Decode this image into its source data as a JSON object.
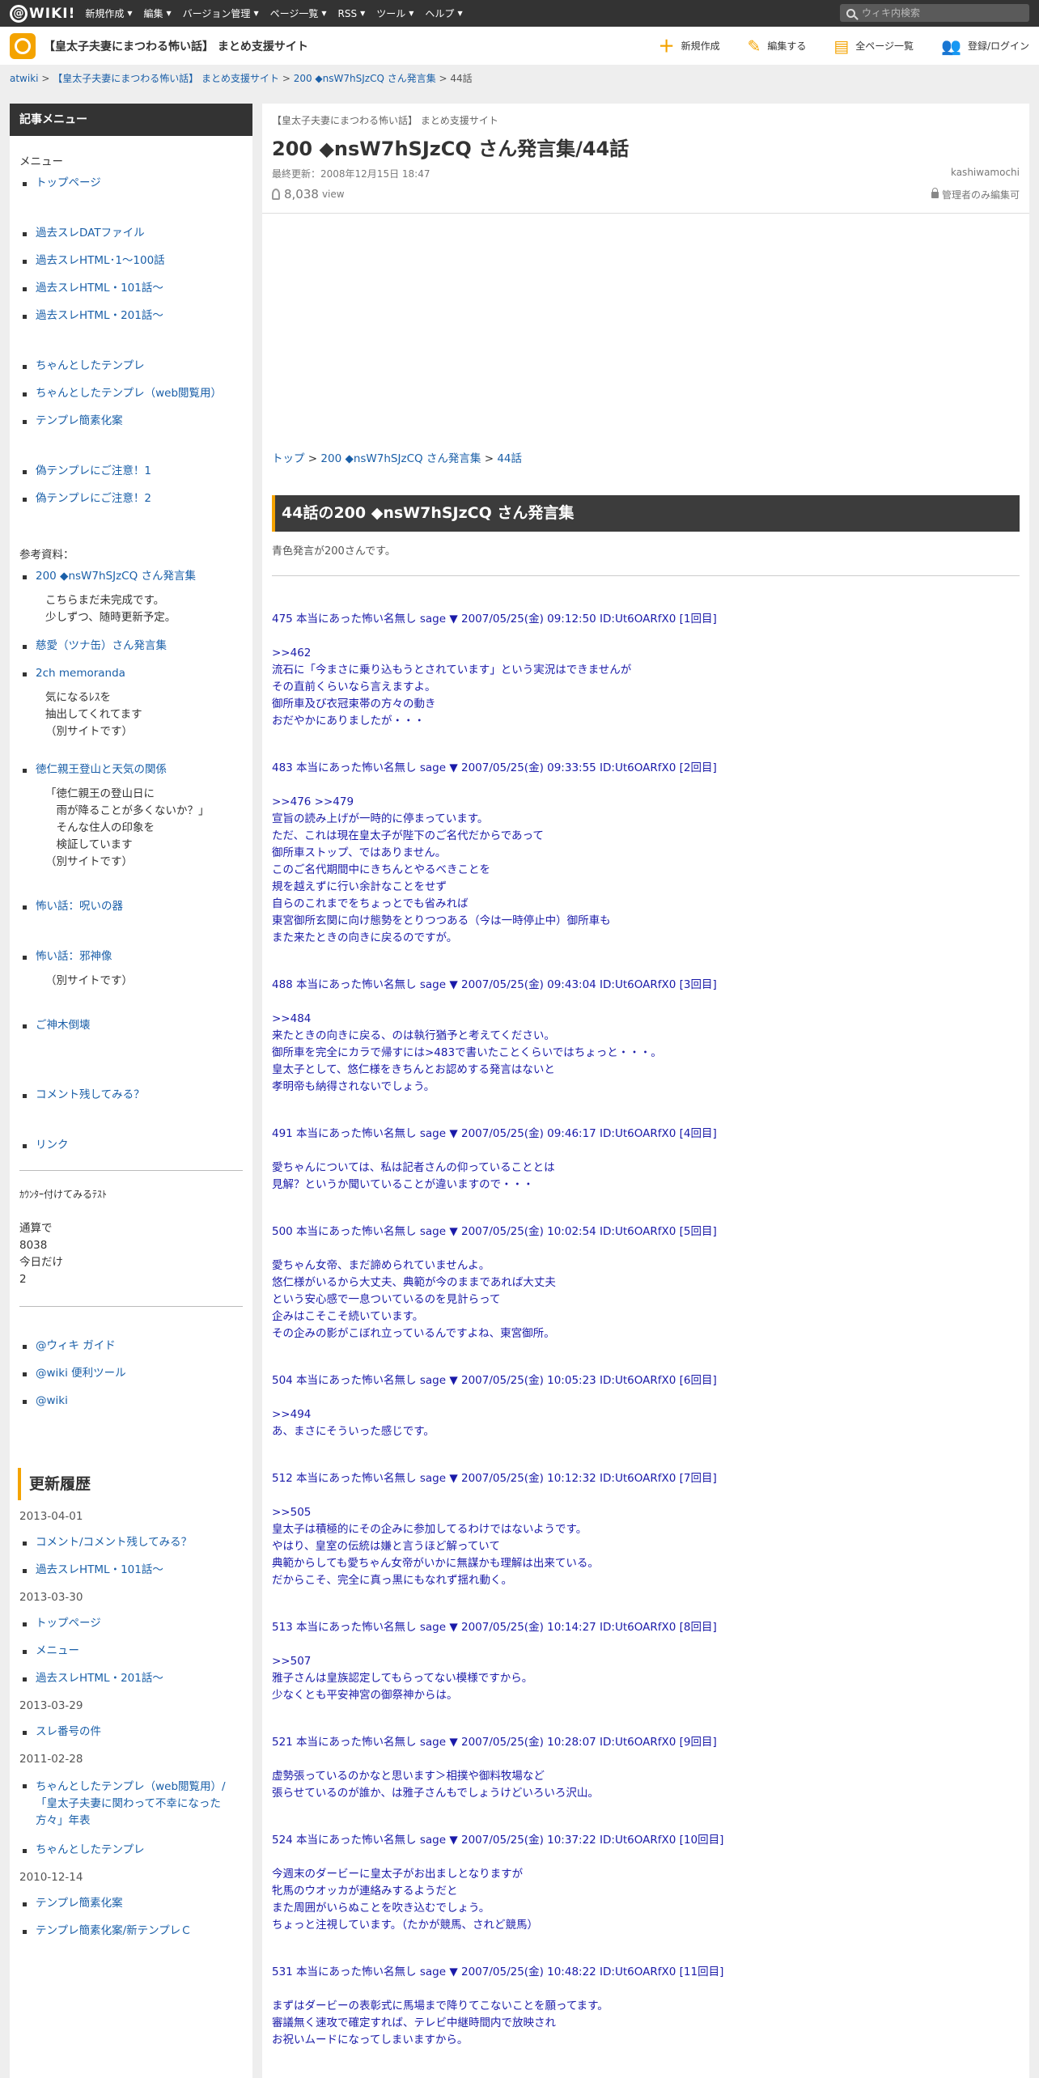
{
  "topbar": {
    "logo": "WIKI!",
    "menu": [
      "新規作成",
      "編集",
      "バージョン管理",
      "ページ一覧",
      "RSS",
      "ツール",
      "ヘルプ"
    ],
    "search_placeholder": "ウィキ内検索"
  },
  "header": {
    "site_title": "【皇太子夫妻にまつわる怖い話】 まとめ支援サイト",
    "actions": [
      "新規作成",
      "編集する",
      "全ページ一覧",
      "登録/ログイン"
    ]
  },
  "breadcrumb": {
    "root": "atwiki",
    "site": "【皇太子夫妻にまつわる怖い話】 まとめ支援サイト",
    "parent": "200 ◆nsW7hSJzCQ さん発言集",
    "current": "44話"
  },
  "sidebar": {
    "title": "記事メニュー",
    "menu_label": "メニュー",
    "group1": [
      "トップページ"
    ],
    "group2": [
      "過去スレDATファイル",
      "過去スレHTML･1～100話",
      "過去スレHTML・101話～",
      "過去スレHTML・201話～"
    ],
    "group3": [
      "ちゃんとしたテンプレ",
      "ちゃんとしたテンプレ（web閲覧用）",
      "テンプレ簡素化案"
    ],
    "group4": [
      "偽テンプレにご注意！1",
      "偽テンプレにご注意！2"
    ],
    "ref_label": "参考資料：",
    "ref1": "200 ◆nsW7hSJzCQ さん発言集",
    "ref1_note": [
      "こちらまだ未完成です。",
      "少しずつ、随時更新予定。"
    ],
    "ref2": "慈愛（ツナ缶）さん発言集",
    "ref3": "2ch memoranda",
    "ref3_note": [
      "気になるﾚｽを",
      "抽出してくれてます",
      "（別サイトです）"
    ],
    "ref4": "徳仁親王登山と天気の関係",
    "ref4_note": [
      "「徳仁親王の登山日に",
      "　雨が降ることが多くないか？」",
      "　そんな住人の印象を",
      "　検証しています",
      "（別サイトです）"
    ],
    "ref5": "怖い話：呪いの器",
    "ref6": "怖い話：邪神像",
    "ref6_note": [
      "（別サイトです）"
    ],
    "ref7": "ご神木倒壊",
    "ref8": "コメント残してみる？",
    "ref9": "リンク",
    "counter_title": "ｶｳﾝﾀｰ付けてみるﾃｽﾄ",
    "counter": [
      "通算で",
      "8038",
      "今日だけ",
      "2"
    ],
    "links": [
      "@ウィキ ガイド",
      "@wiki 便利ツール",
      "@wiki"
    ],
    "update_title": "更新履歴",
    "updates": [
      {
        "date": "2013-04-01",
        "items": [
          "コメント/コメント残してみる？",
          "過去スレHTML・101話～"
        ]
      },
      {
        "date": "2013-03-30",
        "items": [
          "トップページ",
          "メニュー",
          "過去スレHTML・201話～"
        ]
      },
      {
        "date": "2013-03-29",
        "items": [
          "スレ番号の件"
        ]
      },
      {
        "date": "2011-02-28",
        "items": [
          "ちゃんとしたテンプレ（web閲覧用）/「皇太子夫妻に関わって不幸になった方々」年表",
          "ちゃんとしたテンプレ"
        ]
      },
      {
        "date": "2010-12-14",
        "items": [
          "テンプレ簡素化案",
          "テンプレ簡素化案/新テンプレＣ"
        ]
      }
    ]
  },
  "main": {
    "site": "【皇太子夫妻にまつわる怖い話】 まとめ支援サイト",
    "title": "200 ◆nsW7hSJzCQ さん発言集/44話",
    "last_update": "最終更新：2008年12月15日 18:47",
    "user": "kashiwamochi",
    "views": "8,038",
    "view_unit": "view",
    "lock": "管理者のみ編集可",
    "crumb": [
      "トップ",
      "200 ◆nsW7hSJzCQ さん発言集",
      "44話"
    ],
    "heading": "44話の200 ◆nsW7hSJzCQ さん発言集",
    "desc": "青色発言が200さんです。",
    "posts": [
      {
        "head": "475 本当にあった怖い名無し sage ▼ 2007/05/25(金) 09:12:50 ID:Ut6OARfX0 [1回目]",
        "body": ">>462\n流石に「今まさに乗り込もうとされています」という実況はできませんが\nその直前くらいなら言えますよ。\n御所車及び衣冠束帯の方々の動き\nおだやかにありましたが・・・"
      },
      {
        "head": "483 本当にあった怖い名無し sage ▼ 2007/05/25(金) 09:33:55 ID:Ut6OARfX0 [2回目]",
        "body": ">>476 >>479\n宣旨の読み上げが一時的に停まっています。\nただ、これは現在皇太子が陛下のご名代だからであって\n御所車ストップ、ではありません。\nこのご名代期間中にきちんとやるべきことを\n規を越えずに行い余計なことをせず\n自らのこれまでをちょっとでも省みれば\n東宮御所玄関に向け態勢をとりつつある（今は一時停止中）御所車も\nまた来たときの向きに戻るのですが。"
      },
      {
        "head": "488 本当にあった怖い名無し sage ▼ 2007/05/25(金) 09:43:04 ID:Ut6OARfX0 [3回目]",
        "body": ">>484\n来たときの向きに戻る、のは執行猶予と考えてください。\n御所車を完全にカラで帰すには>483で書いたことくらいではちょっと・・・。\n皇太子として、悠仁様をきちんとお認めする発言はないと\n孝明帝も納得されないでしょう。"
      },
      {
        "head": "491 本当にあった怖い名無し sage ▼ 2007/05/25(金) 09:46:17 ID:Ut6OARfX0 [4回目]",
        "body": "愛ちゃんについては、私は記者さんの仰っていることとは\n見解？というか聞いていることが違いますので・・・"
      },
      {
        "head": "500 本当にあった怖い名無し sage ▼ 2007/05/25(金) 10:02:54 ID:Ut6OARfX0 [5回目]",
        "body": "愛ちゃん女帝、まだ諦められていませんよ。\n悠仁様がいるから大丈夫、典範が今のままであれば大丈夫\nという安心感で一息ついているのを見計らって\n企みはこそこそ続いています。\nその企みの影がこぼれ立っているんですよね、東宮御所。"
      },
      {
        "head": "504 本当にあった怖い名無し sage ▼ 2007/05/25(金) 10:05:23 ID:Ut6OARfX0 [6回目]",
        "body": ">>494\nあ、まさにそういった感じです。"
      },
      {
        "head": "512 本当にあった怖い名無し sage ▼ 2007/05/25(金) 10:12:32 ID:Ut6OARfX0 [7回目]",
        "body": ">>505\n皇太子は積極的にその企みに参加してるわけではないようです。\nやはり、皇室の伝統は嫌と言うほど解っていて\n典範からしても愛ちゃん女帝がいかに無謀かも理解は出来ている。\nだからこそ、完全に真っ黒にもなれず揺れ動く。"
      },
      {
        "head": "513 本当にあった怖い名無し sage ▼ 2007/05/25(金) 10:14:27 ID:Ut6OARfX0 [8回目]",
        "body": ">>507\n雅子さんは皇族認定してもらってない模様ですから。\n少なくとも平安神宮の御祭神からは。"
      },
      {
        "head": "521 本当にあった怖い名無し sage ▼ 2007/05/25(金) 10:28:07 ID:Ut6OARfX0 [9回目]",
        "body": "虚勢張っているのかなと思います＞相撲や御料牧場など\n張らせているのが誰か、は雅子さんもでしょうけどいろいろ沢山。"
      },
      {
        "head": "524 本当にあった怖い名無し sage ▼ 2007/05/25(金) 10:37:22 ID:Ut6OARfX0 [10回目]",
        "body": "今週末のダービーに皇太子がお出ましとなりますが\n牝馬のウオッカが連絡みするようだと\nまた周囲がいらぬことを吹き込むでしょう。\nちょっと注視しています。（たかが競馬、されど競馬）"
      },
      {
        "head": "531 本当にあった怖い名無し sage ▼ 2007/05/25(金) 10:48:22 ID:Ut6OARfX0 [11回目]",
        "body": "まずはダービーの表彰式に馬場まで降りてこないことを願ってます。\n審議無く速攻で確定すれば、テレビ中継時間内で放映され\nお祝いムードになってしまいますから。"
      }
    ]
  }
}
